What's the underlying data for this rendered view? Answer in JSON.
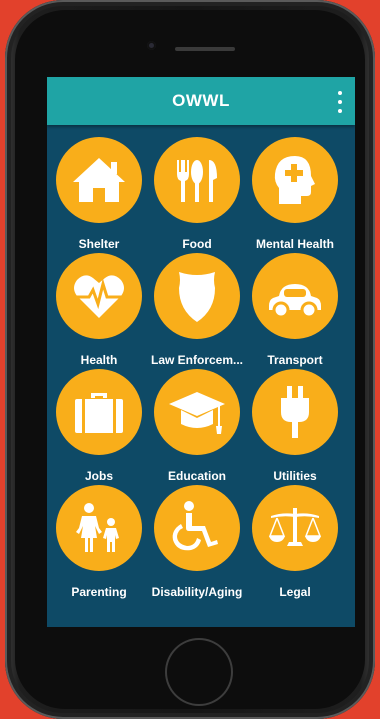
{
  "app": {
    "title": "OWWL"
  },
  "colors": {
    "background": "#e2412c",
    "appbar": "#1fa4a5",
    "screen": "#0e4a66",
    "icon_circle": "#f9ae1a"
  },
  "categories": [
    {
      "label": "Shelter",
      "icon": "house-icon"
    },
    {
      "label": "Food",
      "icon": "utensils-icon"
    },
    {
      "label": "Mental Health",
      "icon": "head-medical-icon"
    },
    {
      "label": "Health",
      "icon": "heart-pulse-icon"
    },
    {
      "label": "Law Enforcem...",
      "icon": "shield-icon"
    },
    {
      "label": "Transport",
      "icon": "car-icon"
    },
    {
      "label": "Jobs",
      "icon": "briefcase-icon"
    },
    {
      "label": "Education",
      "icon": "graduation-cap-icon"
    },
    {
      "label": "Utilities",
      "icon": "plug-icon"
    },
    {
      "label": "Parenting",
      "icon": "parent-child-icon"
    },
    {
      "label": "Disability/Aging",
      "icon": "wheelchair-icon"
    },
    {
      "label": "Legal",
      "icon": "scales-icon"
    }
  ]
}
